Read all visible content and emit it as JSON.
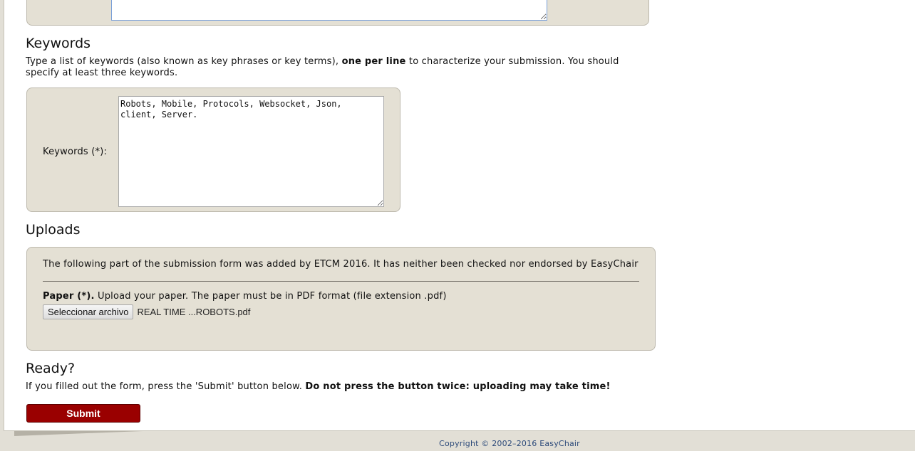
{
  "keywords_section": {
    "title": "Keywords",
    "intro_before": "Type a list of keywords (also known as key phrases or key terms), ",
    "intro_bold": "one per line",
    "intro_after": " to characterize your submission. You should specify at least three keywords.",
    "field_label": "Keywords (*):",
    "field_value": "Robots, Mobile, Protocols, Websocket, Json,\nclient, Server."
  },
  "uploads_section": {
    "title": "Uploads",
    "note": "The following part of the submission form was added by ETCM 2016. It has neither been checked nor endorsed by EasyChair",
    "paper_label": "Paper (*).",
    "paper_description": " Upload your paper. The paper must be in PDF format (file extension .pdf)",
    "file_button_label": "Seleccionar archivo",
    "file_name": "REAL TIME ...ROBOTS.pdf"
  },
  "ready_section": {
    "title": "Ready?",
    "text_before": "If you filled out the form, press the 'Submit' button below. ",
    "text_bold": "Do not press the button twice: uploading may take time!",
    "submit_label": "Submit"
  },
  "footer": {
    "copyright": "Copyright © 2002–2016 EasyChair"
  },
  "colors": {
    "panel_background": "#e4e0d4",
    "submit_button": "#9a0000",
    "footer_text": "#2c4a7a",
    "page_background": "#e2dfd6"
  }
}
